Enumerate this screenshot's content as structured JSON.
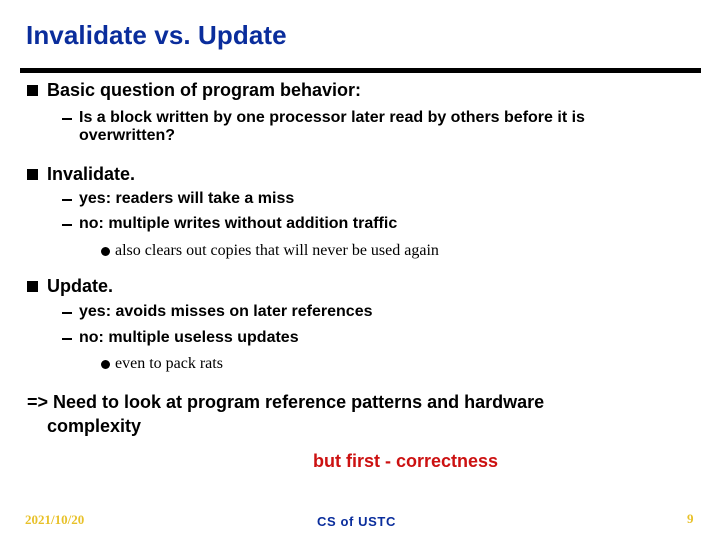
{
  "slide": {
    "title": "Invalidate vs. Update",
    "sections": [
      {
        "label": "Basic question of program behavior:",
        "items": [
          {
            "text_line1": "Is a block written by one processor later read by others before it is",
            "text_line2": "overwritten?"
          }
        ]
      },
      {
        "label": "Invalidate.",
        "items": [
          {
            "text": "yes: readers will take a miss"
          },
          {
            "text": "no: multiple writes without addition traffic",
            "subitems": [
              "also clears out copies that will never be used again"
            ]
          }
        ]
      },
      {
        "label": "Update.",
        "items": [
          {
            "text": "yes: avoids misses on later references"
          },
          {
            "text": "no: multiple useless updates",
            "subitems": [
              "even to pack rats"
            ]
          }
        ]
      }
    ],
    "conclusion_line1": "=> Need to look at program reference patterns and hardware",
    "conclusion_line2": "complexity",
    "note": "but first - correctness",
    "note_color": "#cc1111",
    "title_color": "#0a2d9c"
  },
  "footer": {
    "date": "2021/10/20",
    "center": "CS of USTC",
    "page_number": "9"
  }
}
